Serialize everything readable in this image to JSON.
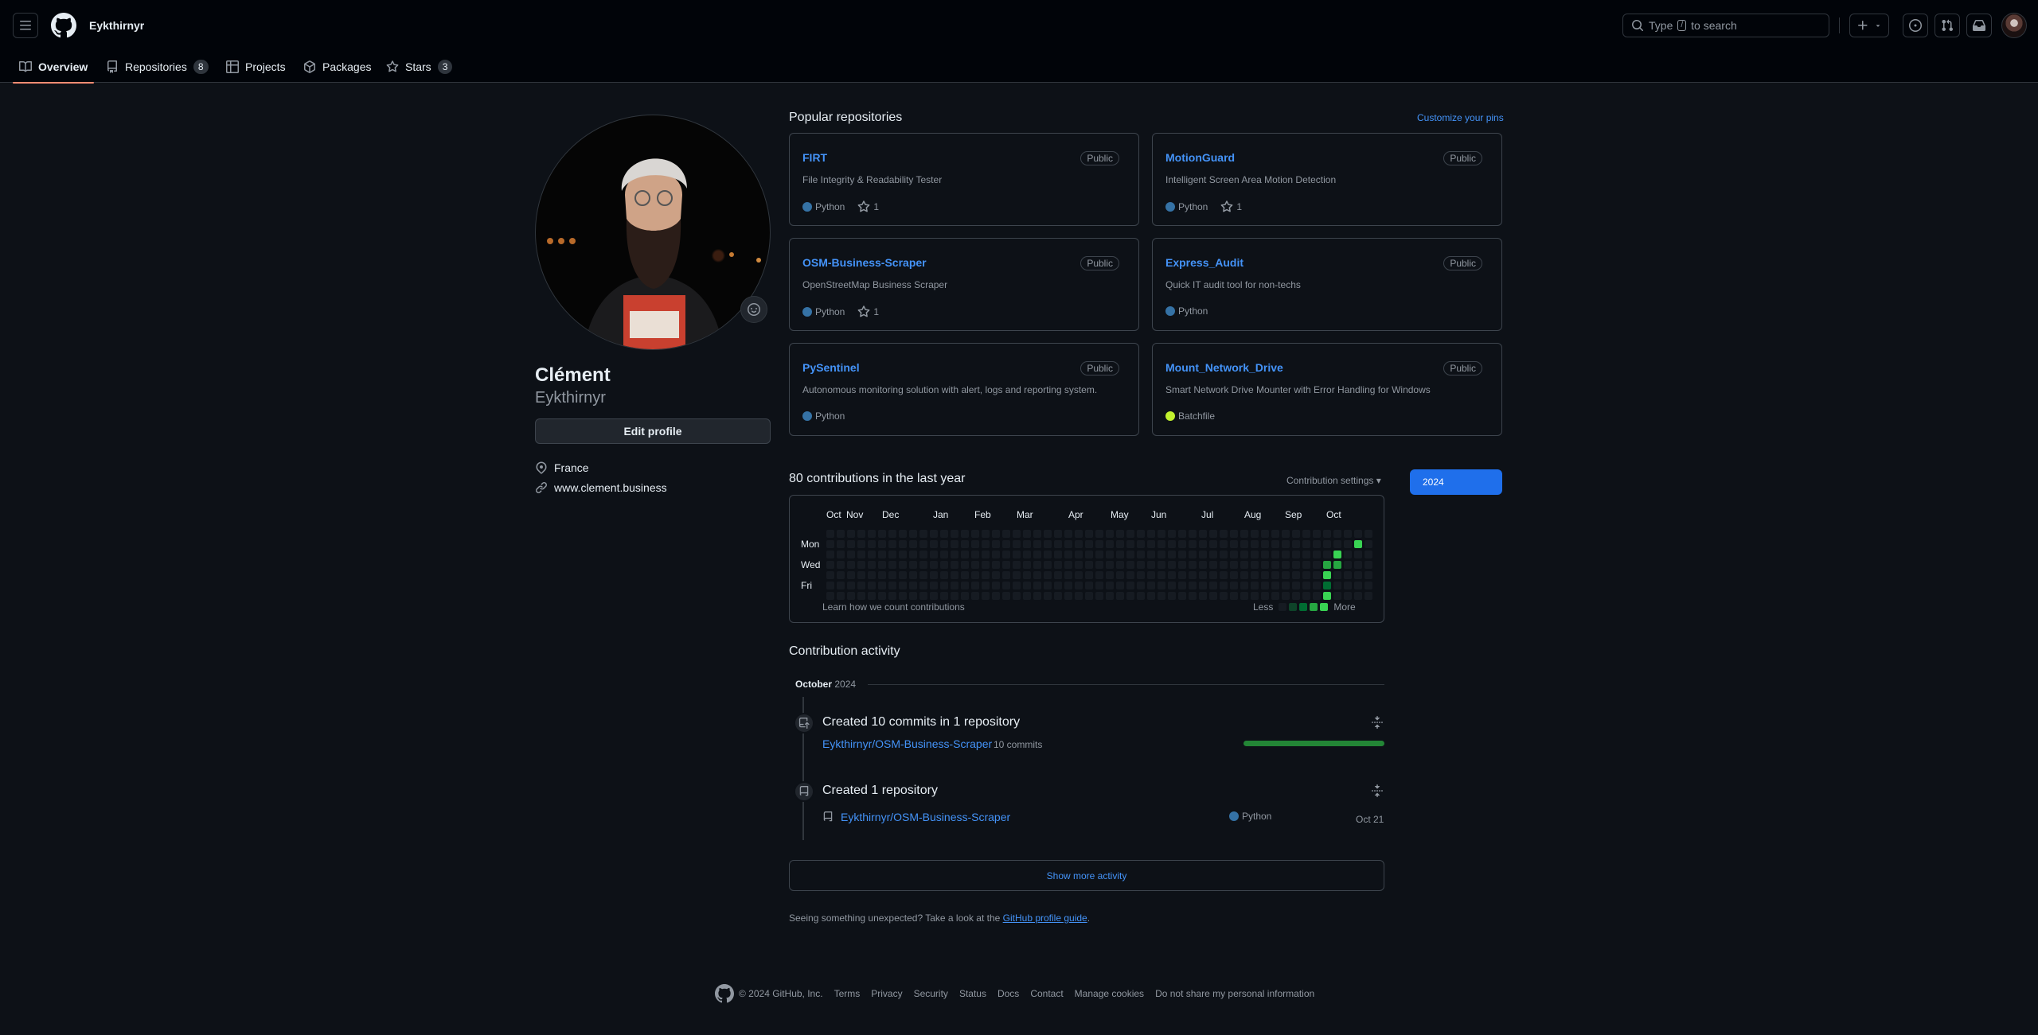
{
  "header": {
    "username": "Eykthirnyr",
    "search": {
      "before": "Type",
      "key": "/",
      "after": "to search"
    },
    "icons": [
      "hamburger-icon",
      "github-logo-icon",
      "search-icon",
      "plus-icon",
      "triangle-down-icon",
      "issue-icon",
      "pull-request-icon",
      "inbox-icon",
      "avatar"
    ]
  },
  "tabs": [
    {
      "label": "Overview",
      "icon": "book-icon",
      "active": true
    },
    {
      "label": "Repositories",
      "icon": "repo-icon",
      "count": "8"
    },
    {
      "label": "Projects",
      "icon": "table-icon"
    },
    {
      "label": "Packages",
      "icon": "package-icon"
    },
    {
      "label": "Stars",
      "icon": "star-icon",
      "count": "3"
    }
  ],
  "profile": {
    "name": "Clément",
    "login": "Eykthirnyr",
    "edit_label": "Edit profile",
    "location": "France",
    "website": "www.clement.business"
  },
  "pinned": {
    "title": "Popular repositories",
    "customize": "Customize your pins",
    "repos": [
      {
        "name": "FIRT",
        "visibility": "Public",
        "description": "File Integrity & Readability Tester",
        "language": "Python",
        "lang_color": "#3572A5",
        "stars": "1"
      },
      {
        "name": "MotionGuard",
        "visibility": "Public",
        "description": "Intelligent Screen Area Motion Detection",
        "language": "Python",
        "lang_color": "#3572A5",
        "stars": "1"
      },
      {
        "name": "OSM-Business-Scraper",
        "visibility": "Public",
        "description": "OpenStreetMap Business Scraper",
        "language": "Python",
        "lang_color": "#3572A5",
        "stars": "1"
      },
      {
        "name": "Express_Audit",
        "visibility": "Public",
        "description": "Quick IT audit tool for non-techs",
        "language": "Python",
        "lang_color": "#3572A5",
        "stars": ""
      },
      {
        "name": "PySentinel",
        "visibility": "Public",
        "description": "Autonomous monitoring solution with alert, logs and reporting system.",
        "language": "Python",
        "lang_color": "#3572A5",
        "stars": ""
      },
      {
        "name": "Mount_Network_Drive",
        "visibility": "Public",
        "description": "Smart Network Drive Mounter with Error Handling for Windows",
        "language": "Batchfile",
        "lang_color": "#C1F12E",
        "stars": ""
      }
    ]
  },
  "contributions": {
    "title": "80 contributions in the last year",
    "settings_label": "Contribution settings",
    "year": "2024",
    "months": [
      "Oct",
      "Nov",
      "Dec",
      "Jan",
      "Feb",
      "Mar",
      "Apr",
      "May",
      "Jun",
      "Jul",
      "Aug",
      "Sep",
      "Oct"
    ],
    "days": [
      "Mon",
      "Wed",
      "Fri"
    ],
    "learn": "Learn how we count contributions",
    "less": "Less",
    "more": "More",
    "levels": [
      "#161b22",
      "#0e4429",
      "#006d32",
      "#26a641",
      "#39d353"
    ],
    "active_cells": [
      {
        "week": 48,
        "day": 3,
        "level": 3
      },
      {
        "week": 48,
        "day": 4,
        "level": 4
      },
      {
        "week": 48,
        "day": 5,
        "level": 2
      },
      {
        "week": 48,
        "day": 6,
        "level": 4
      },
      {
        "week": 49,
        "day": 2,
        "level": 4
      },
      {
        "week": 49,
        "day": 3,
        "level": 3
      },
      {
        "week": 51,
        "day": 1,
        "level": 4
      }
    ]
  },
  "activity": {
    "title": "Contribution activity",
    "month": "October",
    "year": "2024",
    "commits": {
      "title": "Created 10 commits in 1 repository",
      "repo": "Eykthirnyr/OSM-Business-Scraper",
      "count": "10 commits",
      "bar_fraction": 1.0
    },
    "created": {
      "title": "Created 1 repository",
      "repo": "Eykthirnyr/OSM-Business-Scraper",
      "language": "Python",
      "date": "Oct 21"
    },
    "show_more": "Show more activity",
    "unexpected_text": "Seeing something unexpected? Take a look at the",
    "guide_link": "GitHub profile guide",
    "period": "."
  },
  "footer": {
    "copyright": "© 2024 GitHub, Inc.",
    "links": [
      "Terms",
      "Privacy",
      "Security",
      "Status",
      "Docs",
      "Contact",
      "Manage cookies",
      "Do not share my personal information"
    ]
  }
}
